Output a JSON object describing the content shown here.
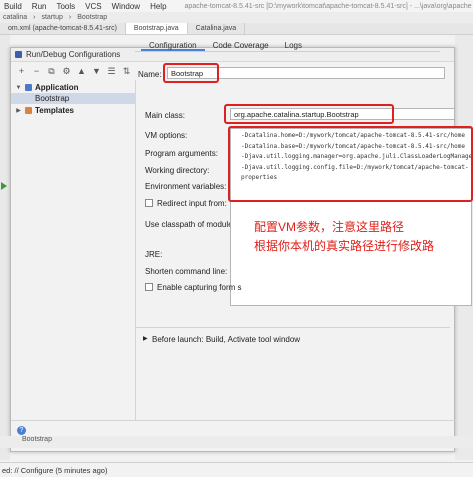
{
  "menubar": {
    "items": [
      "Build",
      "Run",
      "Tools",
      "VCS",
      "Window",
      "Help"
    ],
    "path": "apache-tomcat-8.5.41-src [D:\\mywork\\tomcat\\apache-tomcat-8.5.41-src] - ...\\java\\org\\apache"
  },
  "navbar": {
    "items": [
      "catalina",
      "startup",
      "Bootstrap"
    ]
  },
  "editor_tabs": [
    "om.xml (apache-tomcat-8.5.41-src)",
    "Bootstrap.java",
    "Catalina.java"
  ],
  "dialog": {
    "title": "Run/Debug Configurations",
    "toolbar": [
      "+",
      "−",
      "⧉",
      "⚙",
      "▲",
      "▼",
      "☰",
      "⇅"
    ],
    "tree": {
      "application_label": "Application",
      "bootstrap_label": "Bootstrap",
      "templates_label": "Templates"
    },
    "name_label": "Name:",
    "name_value": "Bootstrap",
    "tabs": [
      "Configuration",
      "Code Coverage",
      "Logs"
    ],
    "main_class_label": "Main class:",
    "main_class_value": "org.apache.catalina.startup.Bootstrap",
    "vm_options_label": "VM options:",
    "vm_options_lines": [
      "-Dcatalina.home=D:/mywork/tomcat/apache-tomcat-8.5.41-src/home",
      "-Dcatalina.base=D:/mywork/tomcat/apache-tomcat-8.5.41-src/home",
      "-Djava.util.logging.manager=org.apache.juli.ClassLoaderLogManager",
      "-Djava.util.logging.config.file=D:/mywork/tomcat/apache-tomcat-",
      "properties"
    ],
    "program_args_label": "Program arguments:",
    "working_dir_label": "Working directory:",
    "env_vars_label": "Environment variables:",
    "redirect_input_label": "Redirect input from:",
    "classpath_label": "Use classpath of module:",
    "jre_label": "JRE:",
    "shorten_cmd_label": "Shorten command line:",
    "capturing_label": "Enable capturing form s",
    "before_launch_label": "Before launch: Build, Activate tool window",
    "help_icon": "?",
    "bottom_text": "Bootstrap"
  },
  "annotation": {
    "line1": "配置VM参数，注意这里路径",
    "line2": "根据你本机的真实路径进行修改路"
  },
  "statusbar": {
    "text": "ed: // Configure (5 minutes ago)"
  },
  "colors": {
    "highlight_red": "#e02020",
    "annotation_red": "#e0201a",
    "selection": "#cfd8e6",
    "accent_blue": "#4a7fd4"
  }
}
